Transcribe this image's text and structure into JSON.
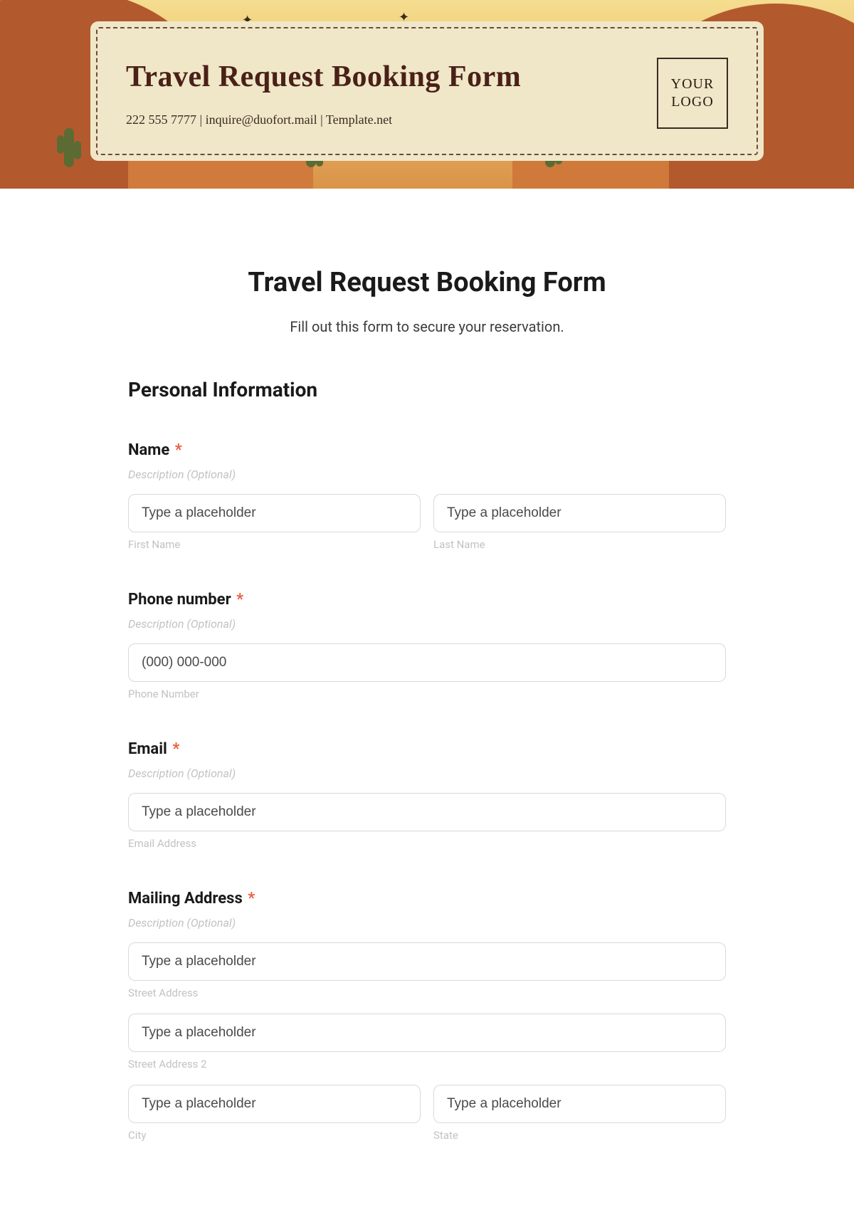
{
  "banner": {
    "title": "Travel Request Booking Form",
    "contact": "222 555 7777 | inquire@duofort.mail | Template.net",
    "logo_text": "YOUR LOGO"
  },
  "form": {
    "title": "Travel Request Booking Form",
    "subtitle": "Fill out this form to secure your reservation.",
    "section_personal": "Personal Information",
    "desc_placeholder": "Description (Optional)",
    "required_mark": "*",
    "name": {
      "label": "Name",
      "first_ph": "Type a placeholder",
      "first_sub": "First Name",
      "last_ph": "Type a placeholder",
      "last_sub": "Last Name"
    },
    "phone": {
      "label": "Phone number",
      "ph": "(000) 000-000",
      "sub": "Phone Number"
    },
    "email": {
      "label": "Email",
      "ph": "Type a placeholder",
      "sub": "Email Address"
    },
    "address": {
      "label": "Mailing Address",
      "street1_ph": "Type a placeholder",
      "street1_sub": "Street Address",
      "street2_ph": "Type a placeholder",
      "street2_sub": "Street Address 2",
      "city_ph": "Type a placeholder",
      "city_sub": "City",
      "state_ph": "Type a placeholder",
      "state_sub": "State"
    }
  }
}
